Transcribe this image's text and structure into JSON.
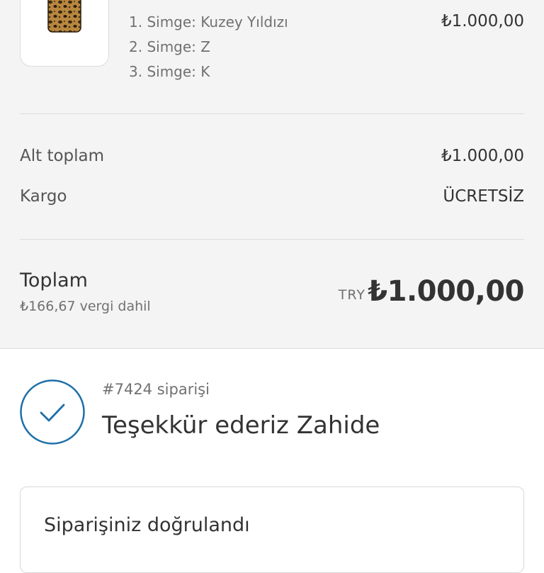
{
  "order_summary": {
    "item": {
      "image_alt": "leopard-print phone case",
      "variants": [
        "1. Simge: Kuzey Yıldızı",
        "2. Simge: Z",
        "3. Simge: K"
      ],
      "price": "₺1.000,00"
    },
    "subtotal": {
      "label": "Alt toplam",
      "value": "₺1.000,00"
    },
    "shipping": {
      "label": "Kargo",
      "value": "ÜCRETSİZ"
    },
    "total": {
      "label": "Toplam",
      "tax_note": "₺166,67 vergi dahil",
      "currency": "TRY",
      "value": "₺1.000,00"
    }
  },
  "confirmation": {
    "order_number": "#7424 siparişi",
    "thanks": "Teşekkür ederiz Zahide",
    "card_title": "Siparişiniz doğrulandı"
  },
  "colors": {
    "summary_bg": "#f4f4f4",
    "accent": "#1f6fa8",
    "text": "#333333",
    "muted": "#717171"
  }
}
